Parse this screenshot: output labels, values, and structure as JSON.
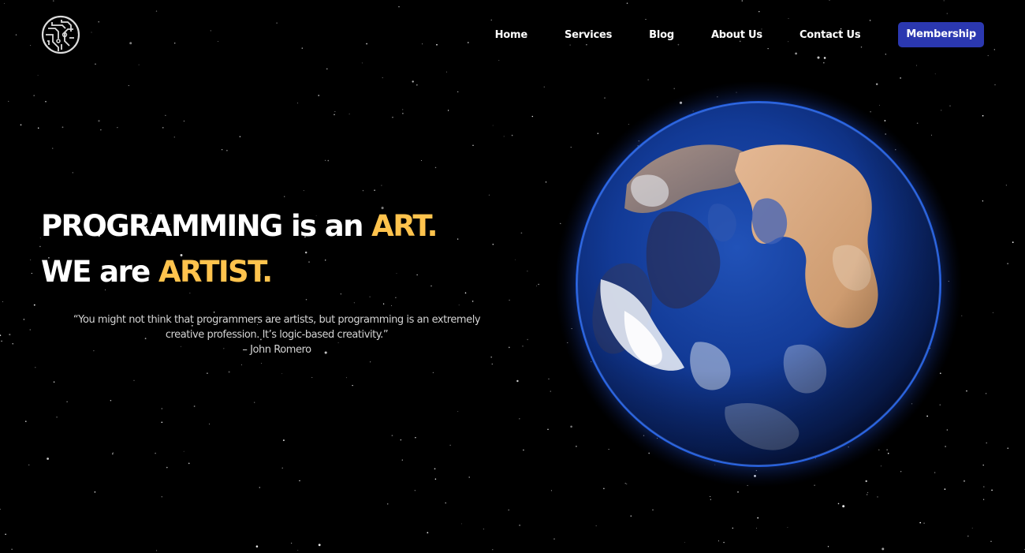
{
  "nav": {
    "items": [
      {
        "label": "Home"
      },
      {
        "label": "Services"
      },
      {
        "label": "Blog"
      },
      {
        "label": "About Us"
      },
      {
        "label": "Contact Us"
      }
    ],
    "cta_label": "Membership"
  },
  "hero": {
    "line1_prefix": "PROGRAMMING is an ",
    "line1_accent": "ART.",
    "line2_prefix": "WE are ",
    "line2_accent": "ARTIST.",
    "quote_line1": "“You might not think that programmers are artists, but programming is an extremely",
    "quote_line2": "creative profession. It’s logic-based creativity.”",
    "quote_author": "– John Romero"
  },
  "colors": {
    "background": "#000000",
    "accent": "#ffc34d",
    "cta": "#2b38b0",
    "text": "#ffffff"
  },
  "icons": {
    "logo": "circuit-circle-logo",
    "planet": "earth-globe"
  }
}
